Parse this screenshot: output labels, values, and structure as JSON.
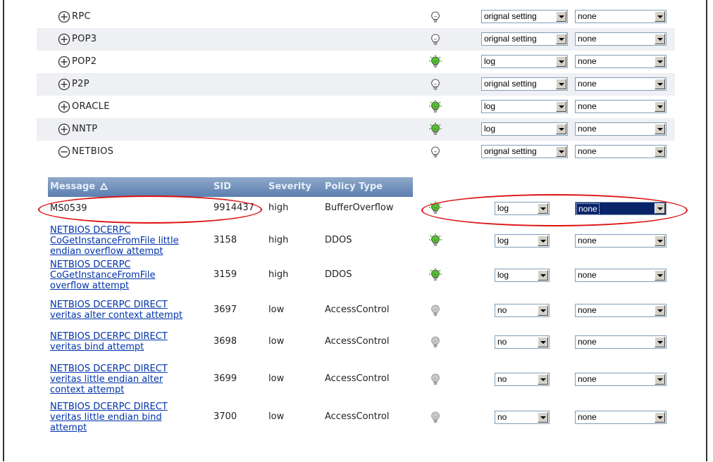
{
  "categories": [
    {
      "toggle": "plus-icon",
      "name": "RPC",
      "bulb": "off",
      "action": "orignal setting",
      "response": "none"
    },
    {
      "toggle": "plus-icon",
      "name": "POP3",
      "bulb": "off",
      "action": "orignal setting",
      "response": "none"
    },
    {
      "toggle": "plus-icon",
      "name": "POP2",
      "bulb": "on",
      "action": "log",
      "response": "none"
    },
    {
      "toggle": "plus-icon",
      "name": "P2P",
      "bulb": "off",
      "action": "orignal setting",
      "response": "none"
    },
    {
      "toggle": "plus-icon",
      "name": "ORACLE",
      "bulb": "on",
      "action": "log",
      "response": "none"
    },
    {
      "toggle": "plus-icon",
      "name": "NNTP",
      "bulb": "on",
      "action": "log",
      "response": "none"
    },
    {
      "toggle": "minus-icon",
      "name": "NETBIOS",
      "bulb": "off",
      "action": "orignal setting",
      "response": "none"
    }
  ],
  "table": {
    "headers": {
      "message": "Message",
      "sort_icon": "sort-up-triangle-icon",
      "sid": "SID",
      "severity": "Severity",
      "policy_type": "Policy Type"
    },
    "rows": [
      {
        "message_lines": [
          "MS0539"
        ],
        "link": false,
        "sid": "9914437",
        "severity": "high",
        "policy": "BufferOverflow",
        "bulb": "on",
        "action": "log",
        "response": "none",
        "response_selected": true
      },
      {
        "message_lines": [
          "NETBIOS DCERPC",
          "CoGetInstanceFromFile little",
          "endian overflow attempt"
        ],
        "link": true,
        "sid": "3158",
        "severity": "high",
        "policy": "DDOS",
        "bulb": "on",
        "action": "log",
        "response": "none"
      },
      {
        "message_lines": [
          "NETBIOS DCERPC",
          "CoGetInstanceFromFile",
          "overflow attempt"
        ],
        "link": true,
        "sid": "3159",
        "severity": "high",
        "policy": "DDOS",
        "bulb": "on",
        "action": "log",
        "response": "none"
      },
      {
        "message_lines": [
          "NETBIOS DCERPC DIRECT",
          "veritas alter context attempt"
        ],
        "link": true,
        "sid": "3697",
        "severity": "low",
        "policy": "AccessControl",
        "bulb": "dim",
        "action": "no",
        "response": "none"
      },
      {
        "message_lines": [
          "NETBIOS DCERPC DIRECT",
          "veritas bind attempt"
        ],
        "link": true,
        "sid": "3698",
        "severity": "low",
        "policy": "AccessControl",
        "bulb": "dim",
        "action": "no",
        "response": "none"
      },
      {
        "message_lines": [
          "NETBIOS DCERPC DIRECT",
          "veritas little endian alter",
          "context attempt"
        ],
        "link": true,
        "sid": "3699",
        "severity": "low",
        "policy": "AccessControl",
        "bulb": "dim",
        "action": "no",
        "response": "none"
      },
      {
        "message_lines": [
          "NETBIOS DCERPC DIRECT",
          "veritas little endian bind",
          "attempt"
        ],
        "link": true,
        "sid": "3700",
        "severity": "low",
        "policy": "AccessControl",
        "bulb": "dim",
        "action": "no",
        "response": "none"
      }
    ]
  },
  "colors": {
    "accent_header": "#5b7fb0",
    "link": "#0033aa",
    "annotation": "#dd1111",
    "bulb_on": "#4fc42a",
    "row_shade": "#eef0f3"
  }
}
